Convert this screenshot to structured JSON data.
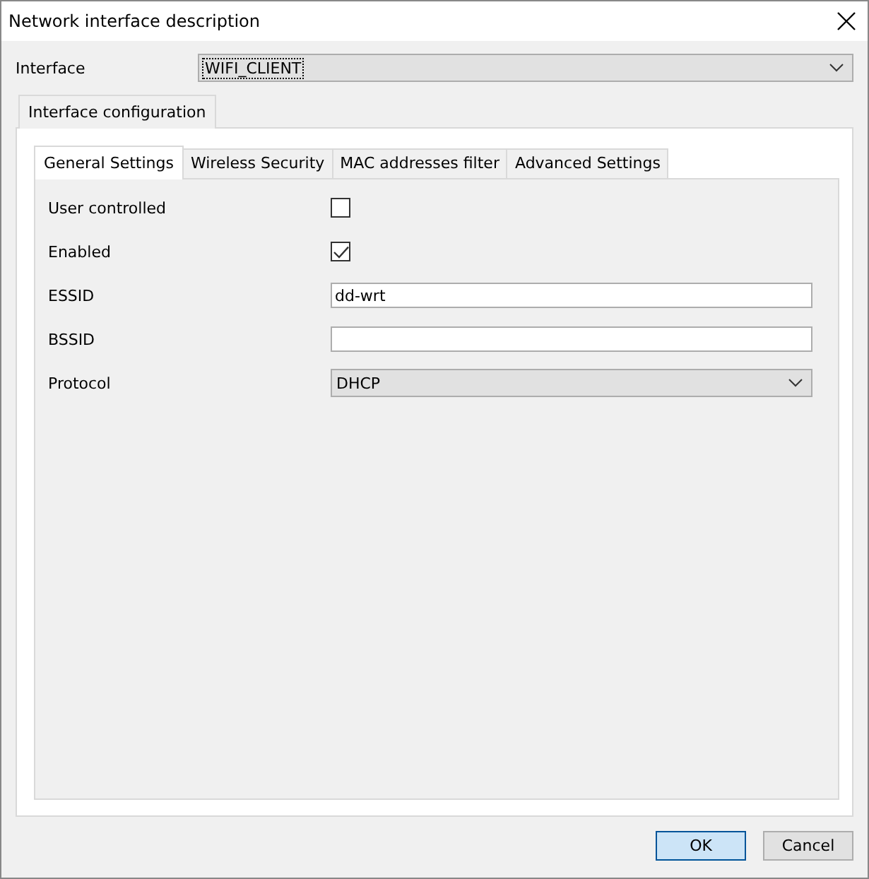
{
  "window": {
    "title": "Network interface description"
  },
  "interface": {
    "label": "Interface",
    "value": "WIFI_CLIENT"
  },
  "outer_tabs": [
    {
      "label": "Interface configuration",
      "selected": true
    }
  ],
  "inner_tabs": [
    {
      "label": "General Settings",
      "selected": true
    },
    {
      "label": "Wireless Security",
      "selected": false
    },
    {
      "label": "MAC addresses filter",
      "selected": false
    },
    {
      "label": "Advanced Settings",
      "selected": false
    }
  ],
  "fields": [
    {
      "kind": "checkbox",
      "label": "User controlled",
      "checked": false
    },
    {
      "kind": "checkbox",
      "label": "Enabled",
      "checked": true
    },
    {
      "kind": "text",
      "label": "ESSID",
      "value": "dd-wrt"
    },
    {
      "kind": "text",
      "label": "BSSID"
    },
    {
      "kind": "select",
      "label": "Protocol",
      "value": "DHCP"
    }
  ],
  "buttons": [
    {
      "label": "OK",
      "default": true
    },
    {
      "label": "Cancel",
      "default": false
    }
  ]
}
